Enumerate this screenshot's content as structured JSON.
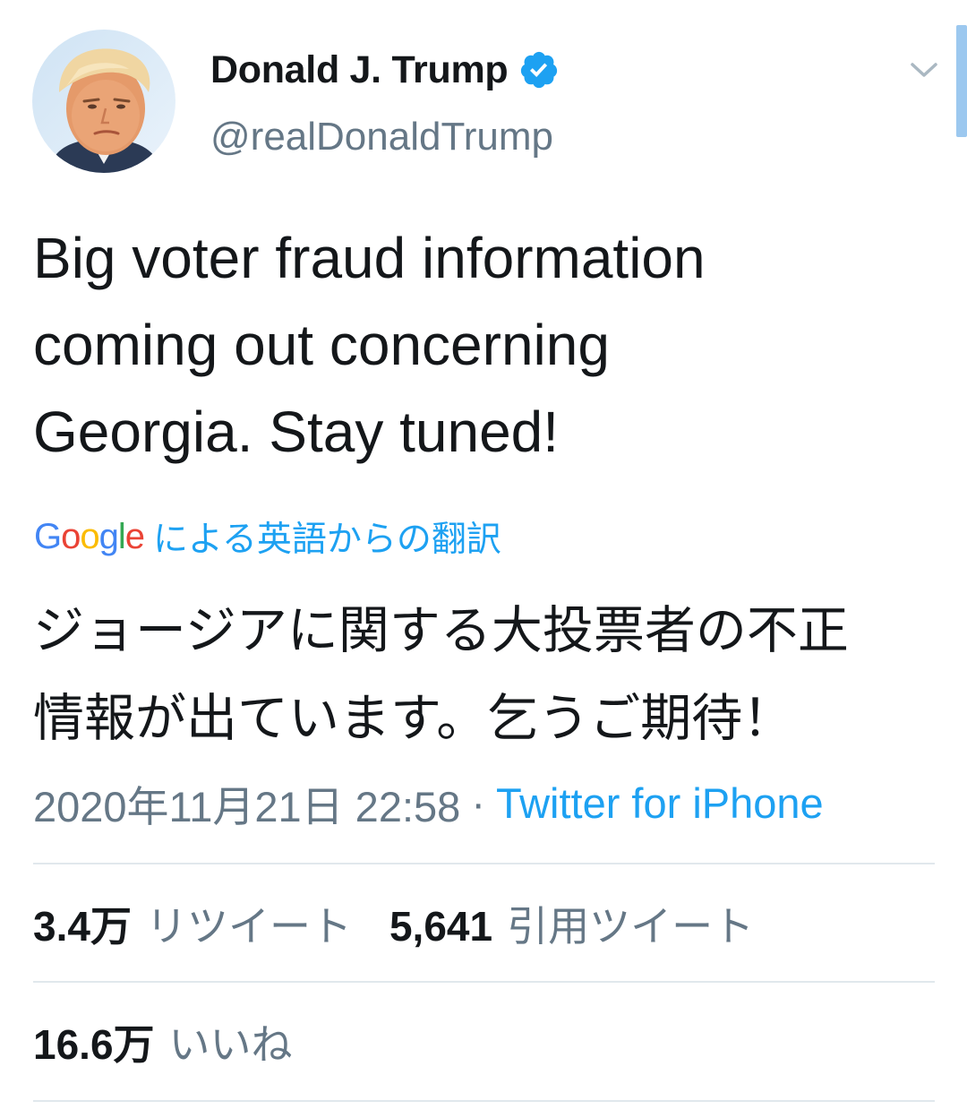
{
  "user": {
    "display_name": "Donald J. Trump",
    "handle": "@realDonaldTrump",
    "verified": true
  },
  "tweet": {
    "text": "Big voter fraud information\ncoming out concerning\nGeorgia. Stay tuned!",
    "translation_provider_letters": [
      "G",
      "o",
      "o",
      "g",
      "l",
      "e"
    ],
    "translation_label": "による英語からの翻訳",
    "translated_text": "ジョージアに関する大投票者の不正\n情報が出ています。乞うご期待！",
    "timestamp": "2020年11月21日 22:58",
    "separator": "·",
    "source": "Twitter for iPhone"
  },
  "stats": {
    "retweets": {
      "count": "3.4万",
      "label": "リツイート"
    },
    "quote_tweets": {
      "count": "5,641",
      "label": "引用ツイート"
    },
    "likes": {
      "count": "16.6万",
      "label": "いいね"
    }
  },
  "colors": {
    "text_primary": "#14171a",
    "text_secondary": "#657786",
    "accent_blue": "#1da1f2",
    "divider": "#e1e8ed",
    "google_blue": "#4285f4",
    "google_red": "#ea4335",
    "google_yellow": "#fbbc05",
    "google_green": "#34a853"
  },
  "icons": {
    "verified": "verified-badge-icon",
    "menu": "chevron-down-icon"
  }
}
